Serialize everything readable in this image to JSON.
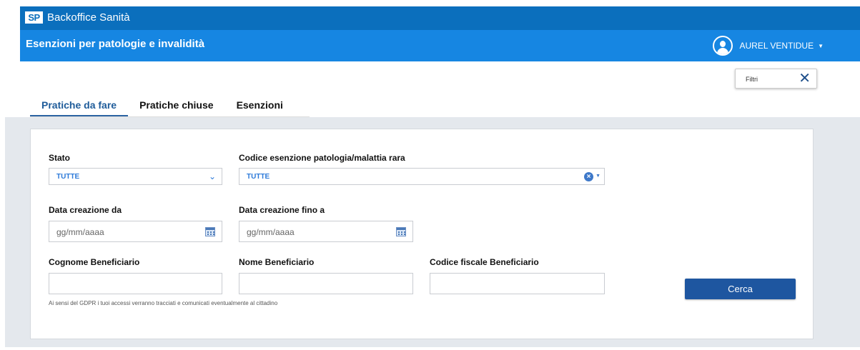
{
  "app": {
    "logo": "SP",
    "title": "Backoffice Sanità"
  },
  "header": {
    "page_title": "Esenzioni per patologie e invalidità",
    "user_name": "AUREL VENTIDUE"
  },
  "filter_chip": {
    "label": "Filtri"
  },
  "tabs": [
    {
      "label": "Pratiche da fare",
      "active": true
    },
    {
      "label": "Pratiche chiuse",
      "active": false
    },
    {
      "label": "Esenzioni",
      "active": false
    }
  ],
  "form": {
    "stato": {
      "label": "Stato",
      "value": "TUTTE"
    },
    "codice": {
      "label": "Codice esenzione patologia/malattia rara",
      "value": "TUTTE"
    },
    "data_da": {
      "label": "Data creazione da",
      "placeholder": "gg/mm/aaaa"
    },
    "data_a": {
      "label": "Data creazione fino a",
      "placeholder": "gg/mm/aaaa"
    },
    "cognome": {
      "label": "Cognome Beneficiario",
      "value": ""
    },
    "nome": {
      "label": "Nome Beneficiario",
      "value": ""
    },
    "codice_fiscale": {
      "label": "Codice fiscale Beneficiario",
      "value": ""
    },
    "search_button": "Cerca",
    "gdpr_notice": "Ai sensi del GDPR i tuoi accessi verranno tracciati e comunicati eventualmente al cittadino"
  },
  "colors": {
    "topbar": "#0b6fbd",
    "subbar": "#1686e2",
    "accent": "#1e56a0",
    "select_text": "#2d7ad9"
  }
}
